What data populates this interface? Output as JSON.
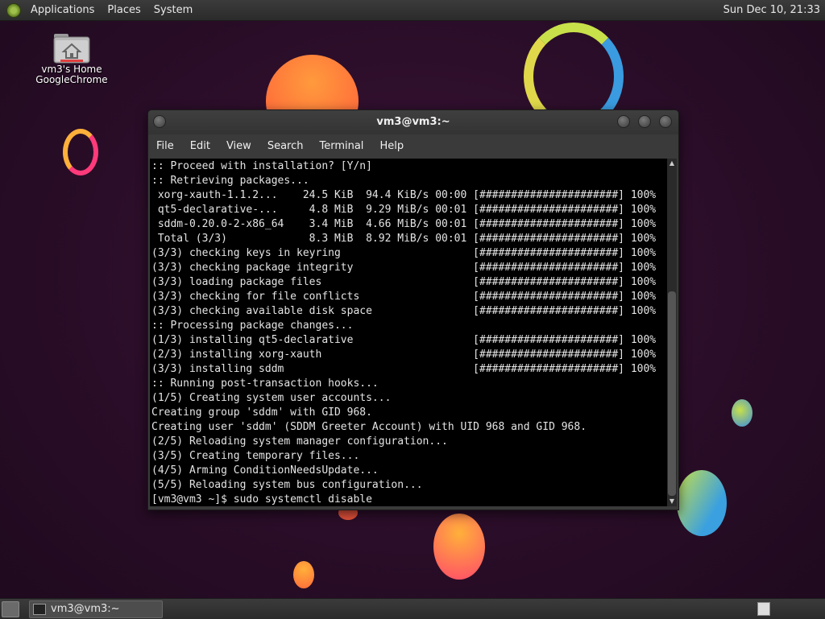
{
  "top_panel": {
    "menus": [
      "Applications",
      "Places",
      "System"
    ],
    "clock": "Sun Dec 10, 21:33"
  },
  "desktop": {
    "home_icon_label": "vm3's Home",
    "overlap_label": "GoogleChrome"
  },
  "terminal": {
    "title": "vm3@vm3:~",
    "menus": [
      "File",
      "Edit",
      "View",
      "Search",
      "Terminal",
      "Help"
    ],
    "lines": [
      ":: Proceed with installation? [Y/n]",
      ":: Retrieving packages...",
      " xorg-xauth-1.1.2...    24.5 KiB  94.4 KiB/s 00:00 [######################] 100%",
      " qt5-declarative-...     4.8 MiB  9.29 MiB/s 00:01 [######################] 100%",
      " sddm-0.20.0-2-x86_64    3.4 MiB  4.66 MiB/s 00:01 [######################] 100%",
      " Total (3/3)             8.3 MiB  8.92 MiB/s 00:01 [######################] 100%",
      "(3/3) checking keys in keyring                     [######################] 100%",
      "(3/3) checking package integrity                   [######################] 100%",
      "(3/3) loading package files                        [######################] 100%",
      "(3/3) checking for file conflicts                  [######################] 100%",
      "(3/3) checking available disk space                [######################] 100%",
      ":: Processing package changes...",
      "(1/3) installing qt5-declarative                   [######################] 100%",
      "(2/3) installing xorg-xauth                        [######################] 100%",
      "(3/3) installing sddm                              [######################] 100%",
      ":: Running post-transaction hooks...",
      "(1/5) Creating system user accounts...",
      "Creating group 'sddm' with GID 968.",
      "Creating user 'sddm' (SDDM Greeter Account) with UID 968 and GID 968.",
      "(2/5) Reloading system manager configuration...",
      "(3/5) Creating temporary files...",
      "(4/5) Arming ConditionNeedsUpdate...",
      "(5/5) Reloading system bus configuration...",
      "[vm3@vm3 ~]$ sudo systemctl disable "
    ]
  },
  "taskbar": {
    "task_label": "vm3@vm3:~"
  },
  "colors": {
    "panel_bg": "#2f2f2f",
    "terminal_bg": "#000000",
    "terminal_fg": "#e4e4e4",
    "desktop_bg": "#2a0d28"
  }
}
